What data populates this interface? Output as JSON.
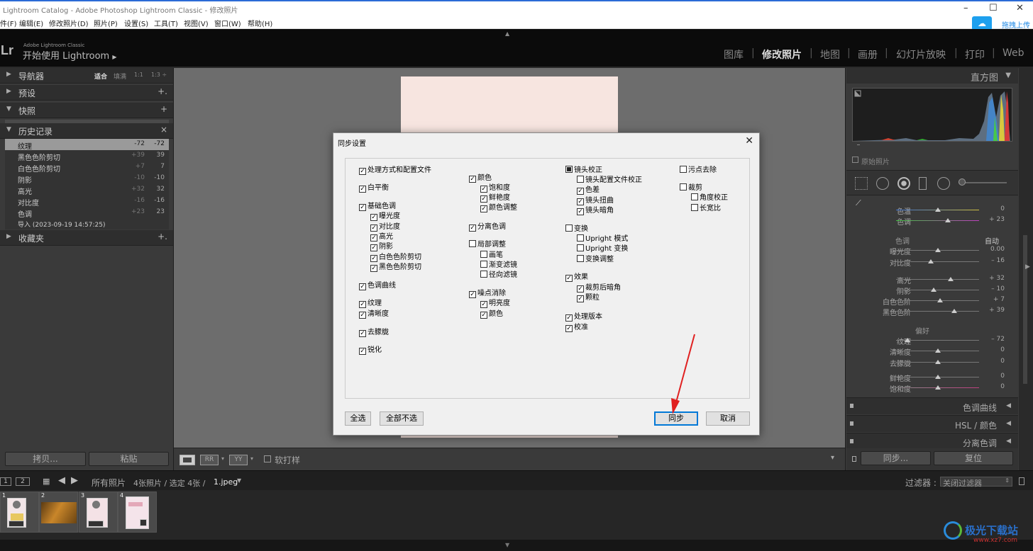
{
  "window": {
    "title": "Lightroom Catalog - Adobe Photoshop Lightroom Classic - 修改照片",
    "controls": {
      "minimize": "–",
      "maximize": "☐",
      "close": "✕"
    }
  },
  "menu": [
    "件(F)",
    "编辑(E)",
    "修改照片(D)",
    "照片(P)",
    "设置(S)",
    "工具(T)",
    "视图(V)",
    "窗口(W)",
    "帮助(H)"
  ],
  "cloud": {
    "label": "拖拽上传"
  },
  "header": {
    "logo": "Lr",
    "product": "Adobe Lightroom Classic",
    "identity": "开始使用 Lightroom",
    "identity_arrow": "▶",
    "modules": [
      "图库",
      "修改照片",
      "地图",
      "画册",
      "幻灯片放映",
      "打印",
      "Web"
    ],
    "active_module": "修改照片"
  },
  "left_panel": {
    "navigator": {
      "label": "导航器",
      "arrow": "▶",
      "zoom": [
        "适合",
        "填满",
        "1:1",
        "1:3 ÷"
      ]
    },
    "presets": {
      "label": "预设",
      "arrow": "▶",
      "action": "+."
    },
    "snapshots": {
      "label": "快照",
      "arrow": "▼",
      "action": "+"
    },
    "history": {
      "label": "历史记录",
      "arrow": "▼",
      "action": "×",
      "items": [
        {
          "name": "纹理",
          "delta": "-72",
          "value": "-72"
        },
        {
          "name": "黑色色阶剪切",
          "delta": "+39",
          "value": "39"
        },
        {
          "name": "白色色阶剪切",
          "delta": "+7",
          "value": "7"
        },
        {
          "name": "阴影",
          "delta": "-10",
          "value": "-10"
        },
        {
          "name": "高光",
          "delta": "+32",
          "value": "32"
        },
        {
          "name": "对比度",
          "delta": "-16",
          "value": "-16"
        },
        {
          "name": "色调",
          "delta": "+23",
          "value": "23"
        },
        {
          "name": "导入 (2023-09-19 14:57:25)",
          "delta": "",
          "value": ""
        }
      ]
    },
    "collections": {
      "label": "收藏夹",
      "arrow": "▶",
      "action": "+."
    },
    "copy_button": "拷贝...",
    "paste_button": "粘贴"
  },
  "toolbar": {
    "soft_proof": "软打样",
    "dropdown": "▾"
  },
  "right_panel": {
    "histogram_label": "直方图",
    "histogram_arrow": "▼",
    "original_photo": "原始照片",
    "basic_group1": [
      {
        "label": "色温",
        "value": "0",
        "level": 0.5
      },
      {
        "label": "色调",
        "value": "+ 23",
        "level": 0.62
      }
    ],
    "tone_header": "色调",
    "tone_auto": "自动",
    "tone_group": [
      {
        "label": "曝光度",
        "value": "0.00",
        "level": 0.5
      },
      {
        "label": "对比度",
        "value": "– 16",
        "level": 0.42
      }
    ],
    "tone_group2": [
      {
        "label": "高光",
        "value": "+ 32",
        "level": 0.66
      },
      {
        "label": "阴影",
        "value": "– 10",
        "level": 0.45
      },
      {
        "label": "白色色阶",
        "value": "+ 7",
        "level": 0.53
      },
      {
        "label": "黑色色阶",
        "value": "+ 39",
        "level": 0.7
      }
    ],
    "presence_header": "偏好",
    "presence_group": [
      {
        "label": "纹理",
        "value": "– 72",
        "level": 0.14
      },
      {
        "label": "清晰度",
        "value": "0",
        "level": 0.5
      },
      {
        "label": "去朦胧",
        "value": "0",
        "level": 0.5
      }
    ],
    "presence_group2": [
      {
        "label": "鲜艳度",
        "value": "0",
        "level": 0.5
      },
      {
        "label": "饱和度",
        "value": "0",
        "level": 0.5
      }
    ],
    "panels": [
      "色调曲线",
      "HSL / 颜色",
      "分离色调"
    ],
    "sync_button": "同步...",
    "reset_button": "复位"
  },
  "filmstrip": {
    "pages": [
      "1",
      "2"
    ],
    "source": "所有照片",
    "info": "4张照片 / 选定 4张 /",
    "file": "1.jpeg",
    "filter_label": "过滤器 :",
    "filter_value": "关闭过滤器",
    "thumbs": [
      "1",
      "2",
      "3",
      "4"
    ]
  },
  "dialog": {
    "title": "同步设置",
    "close": "✕",
    "columns": [
      [
        {
          "label": "处理方式和配置文件",
          "state": "checked",
          "indent": 0
        },
        {
          "label": "白平衡",
          "state": "checked",
          "indent": 0
        },
        {
          "label": "基础色调",
          "state": "checked",
          "indent": 0
        },
        {
          "label": "曝光度",
          "state": "checked",
          "indent": 1
        },
        {
          "label": "对比度",
          "state": "checked",
          "indent": 1
        },
        {
          "label": "高光",
          "state": "checked",
          "indent": 1
        },
        {
          "label": "阴影",
          "state": "checked",
          "indent": 1
        },
        {
          "label": "白色色阶剪切",
          "state": "checked",
          "indent": 1
        },
        {
          "label": "黑色色阶剪切",
          "state": "checked",
          "indent": 1
        },
        {
          "label": "色调曲线",
          "state": "checked",
          "indent": 0
        },
        {
          "label": "纹理",
          "state": "checked",
          "indent": 0
        },
        {
          "label": "清晰度",
          "state": "checked",
          "indent": 0
        },
        {
          "label": "去朦胧",
          "state": "checked",
          "indent": 0
        },
        {
          "label": "锐化",
          "state": "checked",
          "indent": 0
        }
      ],
      [
        {
          "label": "颜色",
          "state": "checked",
          "indent": 0
        },
        {
          "label": "饱和度",
          "state": "checked",
          "indent": 1
        },
        {
          "label": "鲜艳度",
          "state": "checked",
          "indent": 1
        },
        {
          "label": "颜色调整",
          "state": "checked",
          "indent": 1
        },
        {
          "label": "分离色调",
          "state": "checked",
          "indent": 0
        },
        {
          "label": "局部调整",
          "state": "unchecked",
          "indent": 0
        },
        {
          "label": "画笔",
          "state": "unchecked",
          "indent": 1
        },
        {
          "label": "渐变滤镜",
          "state": "unchecked",
          "indent": 1
        },
        {
          "label": "径向滤镜",
          "state": "unchecked",
          "indent": 1
        },
        {
          "label": "噪点消除",
          "state": "checked",
          "indent": 0
        },
        {
          "label": "明亮度",
          "state": "checked",
          "indent": 1
        },
        {
          "label": "颜色",
          "state": "checked",
          "indent": 1
        }
      ],
      [
        {
          "label": "镜头校正",
          "state": "mixed",
          "indent": 0
        },
        {
          "label": "镜头配置文件校正",
          "state": "unchecked",
          "indent": 1
        },
        {
          "label": "色差",
          "state": "checked",
          "indent": 1
        },
        {
          "label": "镜头扭曲",
          "state": "checked",
          "indent": 1
        },
        {
          "label": "镜头暗角",
          "state": "checked",
          "indent": 1
        },
        {
          "label": "变换",
          "state": "unchecked",
          "indent": 0
        },
        {
          "label": "Upright 模式",
          "state": "unchecked",
          "indent": 1
        },
        {
          "label": "Upright 变换",
          "state": "unchecked",
          "indent": 1
        },
        {
          "label": "变换调整",
          "state": "unchecked",
          "indent": 1
        },
        {
          "label": "效果",
          "state": "checked",
          "indent": 0
        },
        {
          "label": "裁剪后暗角",
          "state": "checked",
          "indent": 1
        },
        {
          "label": "颗粒",
          "state": "checked",
          "indent": 1
        },
        {
          "label": "处理版本",
          "state": "checked",
          "indent": 0
        },
        {
          "label": "校准",
          "state": "checked",
          "indent": 0
        }
      ],
      [
        {
          "label": "污点去除",
          "state": "unchecked",
          "indent": 0
        },
        {
          "label": "裁剪",
          "state": "unchecked",
          "indent": 0
        },
        {
          "label": "角度校正",
          "state": "unchecked",
          "indent": 1
        },
        {
          "label": "长宽比",
          "state": "unchecked",
          "indent": 1
        }
      ]
    ],
    "select_all": "全选",
    "select_none": "全部不选",
    "sync": "同步",
    "cancel": "取消"
  },
  "watermark": {
    "text": "极光下载站",
    "url": "www.xz7.com"
  }
}
